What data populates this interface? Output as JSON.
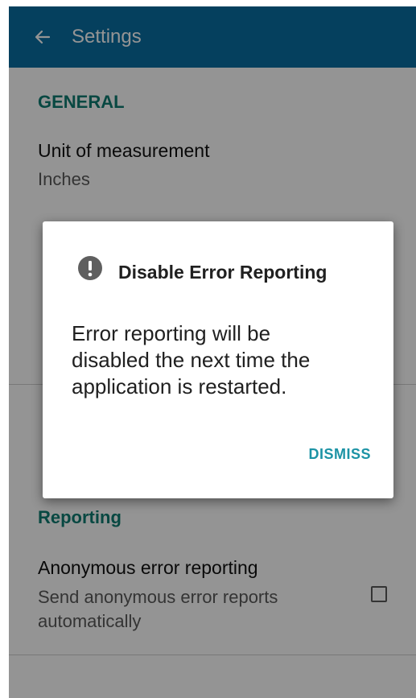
{
  "app_bar": {
    "title": "Settings",
    "back_icon": "arrow-left-icon"
  },
  "sections": {
    "general": {
      "header": "GENERAL",
      "unit_pref": {
        "title": "Unit of measurement",
        "summary": "Inches"
      }
    },
    "reporting": {
      "header": "Reporting",
      "error_pref": {
        "title": "Anonymous error reporting",
        "summary_line1": "Send anonymous error reports",
        "summary_line2": "automatically",
        "checked": false
      }
    }
  },
  "dialog": {
    "icon": "alert-circle-icon",
    "title": "Disable Error Reporting",
    "message_line1": "Error reporting will be",
    "message_line2": "disabled the next time the",
    "message_line3": "application is restarted.",
    "dismiss_label": "DISMISS"
  },
  "colors": {
    "app_bar": "#0a6ea3",
    "accent_teal": "#0e7d72",
    "dialog_button": "#1c93a5"
  }
}
